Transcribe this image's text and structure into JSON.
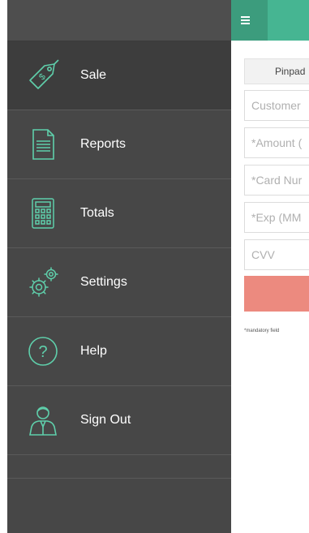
{
  "menu": {
    "items": [
      {
        "label": "Sale",
        "icon": "price-tag-icon"
      },
      {
        "label": "Reports",
        "icon": "document-icon"
      },
      {
        "label": "Totals",
        "icon": "calculator-icon"
      },
      {
        "label": "Settings",
        "icon": "gears-icon"
      },
      {
        "label": "Help",
        "icon": "question-icon"
      },
      {
        "label": "Sign Out",
        "icon": "user-icon"
      }
    ]
  },
  "form": {
    "pinpad_label": "Pinpad",
    "customer_placeholder": "Customer",
    "amount_placeholder": "*Amount (",
    "card_number_placeholder": "*Card Nur",
    "exp_placeholder": "*Exp (MM",
    "cvv_placeholder": "CVV",
    "mandatory_note": "*mandatory field"
  },
  "colors": {
    "accent": "#46b592",
    "icon": "#5fcfab",
    "drawer": "#474747",
    "submit": "#ec8a7f"
  }
}
